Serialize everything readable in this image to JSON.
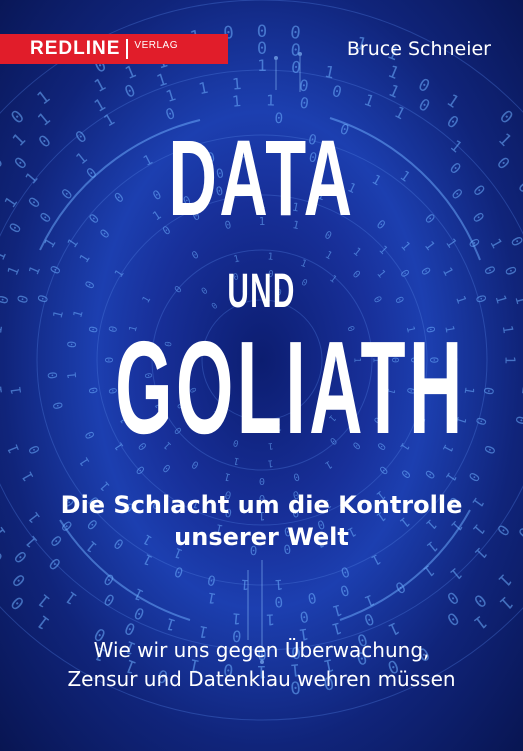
{
  "cover": {
    "publisher": {
      "name": "REDLINE",
      "imprint": "VERLAG"
    },
    "author": "Bruce Schneier",
    "title": {
      "line1": "DATA",
      "line2": "UND",
      "line3": "GOLIATH"
    },
    "subtitle": {
      "line1": "Die Schlacht um die Kontrolle",
      "line2": "unserer Welt"
    },
    "tagline": {
      "line1": "Wie wir uns gegen Überwachung,",
      "line2": "Zensur und Datenklau wehren müssen"
    },
    "colors": {
      "background": "#1c3fb0",
      "publisher_bar": "#e11d2a",
      "text": "#ffffff",
      "binary_digits": "#6fb0ff"
    },
    "background_motif": "binary-tunnel"
  }
}
